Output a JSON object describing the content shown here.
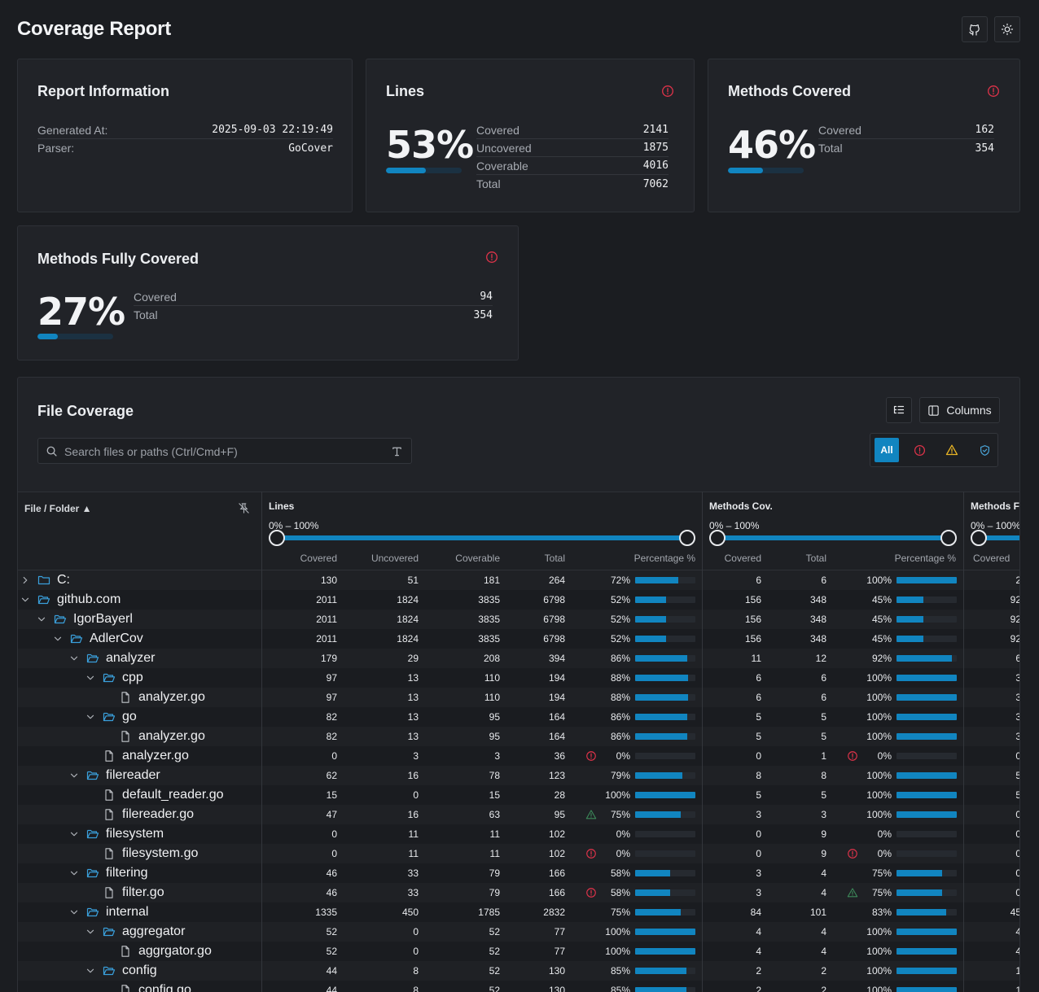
{
  "page": {
    "title": "Coverage Report"
  },
  "header": {
    "github_icon": "github-icon",
    "theme_icon": "sun-icon"
  },
  "report_info": {
    "title": "Report Information",
    "generated_label": "Generated At:",
    "generated_value": "2025-09-03 22:19:49",
    "parser_label": "Parser:",
    "parser_value": "GoCover"
  },
  "lines_card": {
    "title": "Lines",
    "pct": "53%",
    "pct_value": 53,
    "rows": [
      {
        "label": "Covered",
        "value": "2141"
      },
      {
        "label": "Uncovered",
        "value": "1875"
      },
      {
        "label": "Coverable",
        "value": "4016"
      },
      {
        "label": "Total",
        "value": "7062"
      }
    ]
  },
  "methods_card": {
    "title": "Methods Covered",
    "pct": "46%",
    "pct_value": 46,
    "rows": [
      {
        "label": "Covered",
        "value": "162"
      },
      {
        "label": "Total",
        "value": "354"
      }
    ]
  },
  "methods_full_card": {
    "title": "Methods Fully Covered",
    "pct": "27%",
    "pct_value": 27,
    "rows": [
      {
        "label": "Covered",
        "value": "94"
      },
      {
        "label": "Total",
        "value": "354"
      }
    ]
  },
  "file_coverage": {
    "title": "File Coverage",
    "search_placeholder": "Search files or paths (Ctrl/Cmd+F)",
    "columns_label": "Columns",
    "filter_all": "All",
    "colors": {
      "accent": "#1185c0",
      "danger": "#e0334a",
      "warning": "#e8b425",
      "success": "#3d8a5a"
    }
  },
  "table": {
    "file_col": "File / Folder ▲",
    "groups": [
      {
        "label": "Lines",
        "range": "0% – 100%",
        "subs": [
          "Covered",
          "Uncovered",
          "Coverable",
          "Total",
          "Percentage %"
        ]
      },
      {
        "label": "Methods Cov.",
        "range": "0% – 100%",
        "subs": [
          "Covered",
          "Total",
          "Percentage %"
        ]
      },
      {
        "label": "Methods Fu",
        "range": "0% – 100%",
        "subs": [
          "Covered"
        ]
      }
    ],
    "rows": [
      {
        "depth": 0,
        "type": "folder",
        "expanded": false,
        "name": "C:",
        "cov": "130",
        "unc": "51",
        "cvb": "181",
        "tot": "264",
        "pct": "72%",
        "p": 72,
        "risk": "",
        "mcov": "6",
        "mtot": "6",
        "mpct": "100%",
        "mp": 100,
        "mrisk": "",
        "mf": "2"
      },
      {
        "depth": 0,
        "type": "folder",
        "expanded": true,
        "name": "github.com",
        "cov": "2011",
        "unc": "1824",
        "cvb": "3835",
        "tot": "6798",
        "pct": "52%",
        "p": 52,
        "risk": "",
        "mcov": "156",
        "mtot": "348",
        "mpct": "45%",
        "mp": 45,
        "mrisk": "",
        "mf": "92"
      },
      {
        "depth": 1,
        "type": "folder",
        "expanded": true,
        "name": "IgorBayerl",
        "cov": "2011",
        "unc": "1824",
        "cvb": "3835",
        "tot": "6798",
        "pct": "52%",
        "p": 52,
        "risk": "",
        "mcov": "156",
        "mtot": "348",
        "mpct": "45%",
        "mp": 45,
        "mrisk": "",
        "mf": "92"
      },
      {
        "depth": 2,
        "type": "folder",
        "expanded": true,
        "name": "AdlerCov",
        "cov": "2011",
        "unc": "1824",
        "cvb": "3835",
        "tot": "6798",
        "pct": "52%",
        "p": 52,
        "risk": "",
        "mcov": "156",
        "mtot": "348",
        "mpct": "45%",
        "mp": 45,
        "mrisk": "",
        "mf": "92"
      },
      {
        "depth": 3,
        "type": "folder",
        "expanded": true,
        "name": "analyzer",
        "cov": "179",
        "unc": "29",
        "cvb": "208",
        "tot": "394",
        "pct": "86%",
        "p": 86,
        "risk": "",
        "mcov": "11",
        "mtot": "12",
        "mpct": "92%",
        "mp": 92,
        "mrisk": "",
        "mf": "6"
      },
      {
        "depth": 4,
        "type": "folder",
        "expanded": true,
        "name": "cpp",
        "cov": "97",
        "unc": "13",
        "cvb": "110",
        "tot": "194",
        "pct": "88%",
        "p": 88,
        "risk": "",
        "mcov": "6",
        "mtot": "6",
        "mpct": "100%",
        "mp": 100,
        "mrisk": "",
        "mf": "3"
      },
      {
        "depth": 5,
        "type": "file",
        "name": "analyzer.go",
        "cov": "97",
        "unc": "13",
        "cvb": "110",
        "tot": "194",
        "pct": "88%",
        "p": 88,
        "risk": "",
        "mcov": "6",
        "mtot": "6",
        "mpct": "100%",
        "mp": 100,
        "mrisk": "",
        "mf": "3"
      },
      {
        "depth": 4,
        "type": "folder",
        "expanded": true,
        "name": "go",
        "cov": "82",
        "unc": "13",
        "cvb": "95",
        "tot": "164",
        "pct": "86%",
        "p": 86,
        "risk": "",
        "mcov": "5",
        "mtot": "5",
        "mpct": "100%",
        "mp": 100,
        "mrisk": "",
        "mf": "3"
      },
      {
        "depth": 5,
        "type": "file",
        "name": "analyzer.go",
        "cov": "82",
        "unc": "13",
        "cvb": "95",
        "tot": "164",
        "pct": "86%",
        "p": 86,
        "risk": "",
        "mcov": "5",
        "mtot": "5",
        "mpct": "100%",
        "mp": 100,
        "mrisk": "",
        "mf": "3"
      },
      {
        "depth": 4,
        "type": "file",
        "name": "analyzer.go",
        "cov": "0",
        "unc": "3",
        "cvb": "3",
        "tot": "36",
        "pct": "0%",
        "p": 0,
        "risk": "danger",
        "mcov": "0",
        "mtot": "1",
        "mpct": "0%",
        "mp": 0,
        "mrisk": "danger",
        "mf": "0"
      },
      {
        "depth": 3,
        "type": "folder",
        "expanded": true,
        "name": "filereader",
        "cov": "62",
        "unc": "16",
        "cvb": "78",
        "tot": "123",
        "pct": "79%",
        "p": 79,
        "risk": "",
        "mcov": "8",
        "mtot": "8",
        "mpct": "100%",
        "mp": 100,
        "mrisk": "",
        "mf": "5"
      },
      {
        "depth": 4,
        "type": "file",
        "name": "default_reader.go",
        "cov": "15",
        "unc": "0",
        "cvb": "15",
        "tot": "28",
        "pct": "100%",
        "p": 100,
        "risk": "",
        "mcov": "5",
        "mtot": "5",
        "mpct": "100%",
        "mp": 100,
        "mrisk": "",
        "mf": "5"
      },
      {
        "depth": 4,
        "type": "file",
        "name": "filereader.go",
        "cov": "47",
        "unc": "16",
        "cvb": "63",
        "tot": "95",
        "pct": "75%",
        "p": 75,
        "risk": "success",
        "mcov": "3",
        "mtot": "3",
        "mpct": "100%",
        "mp": 100,
        "mrisk": "",
        "mf": "0"
      },
      {
        "depth": 3,
        "type": "folder",
        "expanded": true,
        "name": "filesystem",
        "cov": "0",
        "unc": "11",
        "cvb": "11",
        "tot": "102",
        "pct": "0%",
        "p": 0,
        "risk": "",
        "mcov": "0",
        "mtot": "9",
        "mpct": "0%",
        "mp": 0,
        "mrisk": "",
        "mf": "0"
      },
      {
        "depth": 4,
        "type": "file",
        "name": "filesystem.go",
        "cov": "0",
        "unc": "11",
        "cvb": "11",
        "tot": "102",
        "pct": "0%",
        "p": 0,
        "risk": "danger",
        "mcov": "0",
        "mtot": "9",
        "mpct": "0%",
        "mp": 0,
        "mrisk": "danger",
        "mf": "0"
      },
      {
        "depth": 3,
        "type": "folder",
        "expanded": true,
        "name": "filtering",
        "cov": "46",
        "unc": "33",
        "cvb": "79",
        "tot": "166",
        "pct": "58%",
        "p": 58,
        "risk": "",
        "mcov": "3",
        "mtot": "4",
        "mpct": "75%",
        "mp": 75,
        "mrisk": "",
        "mf": "0"
      },
      {
        "depth": 4,
        "type": "file",
        "name": "filter.go",
        "cov": "46",
        "unc": "33",
        "cvb": "79",
        "tot": "166",
        "pct": "58%",
        "p": 58,
        "risk": "danger",
        "mcov": "3",
        "mtot": "4",
        "mpct": "75%",
        "mp": 75,
        "mrisk": "success",
        "mf": "0"
      },
      {
        "depth": 3,
        "type": "folder",
        "expanded": true,
        "name": "internal",
        "cov": "1335",
        "unc": "450",
        "cvb": "1785",
        "tot": "2832",
        "pct": "75%",
        "p": 75,
        "risk": "",
        "mcov": "84",
        "mtot": "101",
        "mpct": "83%",
        "mp": 83,
        "mrisk": "",
        "mf": "45"
      },
      {
        "depth": 4,
        "type": "folder",
        "expanded": true,
        "name": "aggregator",
        "cov": "52",
        "unc": "0",
        "cvb": "52",
        "tot": "77",
        "pct": "100%",
        "p": 100,
        "risk": "",
        "mcov": "4",
        "mtot": "4",
        "mpct": "100%",
        "mp": 100,
        "mrisk": "",
        "mf": "4"
      },
      {
        "depth": 5,
        "type": "file",
        "name": "aggrgator.go",
        "cov": "52",
        "unc": "0",
        "cvb": "52",
        "tot": "77",
        "pct": "100%",
        "p": 100,
        "risk": "",
        "mcov": "4",
        "mtot": "4",
        "mpct": "100%",
        "mp": 100,
        "mrisk": "",
        "mf": "4"
      },
      {
        "depth": 4,
        "type": "folder",
        "expanded": true,
        "name": "config",
        "cov": "44",
        "unc": "8",
        "cvb": "52",
        "tot": "130",
        "pct": "85%",
        "p": 85,
        "risk": "",
        "mcov": "2",
        "mtot": "2",
        "mpct": "100%",
        "mp": 100,
        "mrisk": "",
        "mf": "1"
      },
      {
        "depth": 5,
        "type": "file",
        "name": "config.go",
        "cov": "44",
        "unc": "8",
        "cvb": "52",
        "tot": "130",
        "pct": "85%",
        "p": 85,
        "risk": "",
        "mcov": "2",
        "mtot": "2",
        "mpct": "100%",
        "mp": 100,
        "mrisk": "",
        "mf": "1"
      }
    ]
  }
}
